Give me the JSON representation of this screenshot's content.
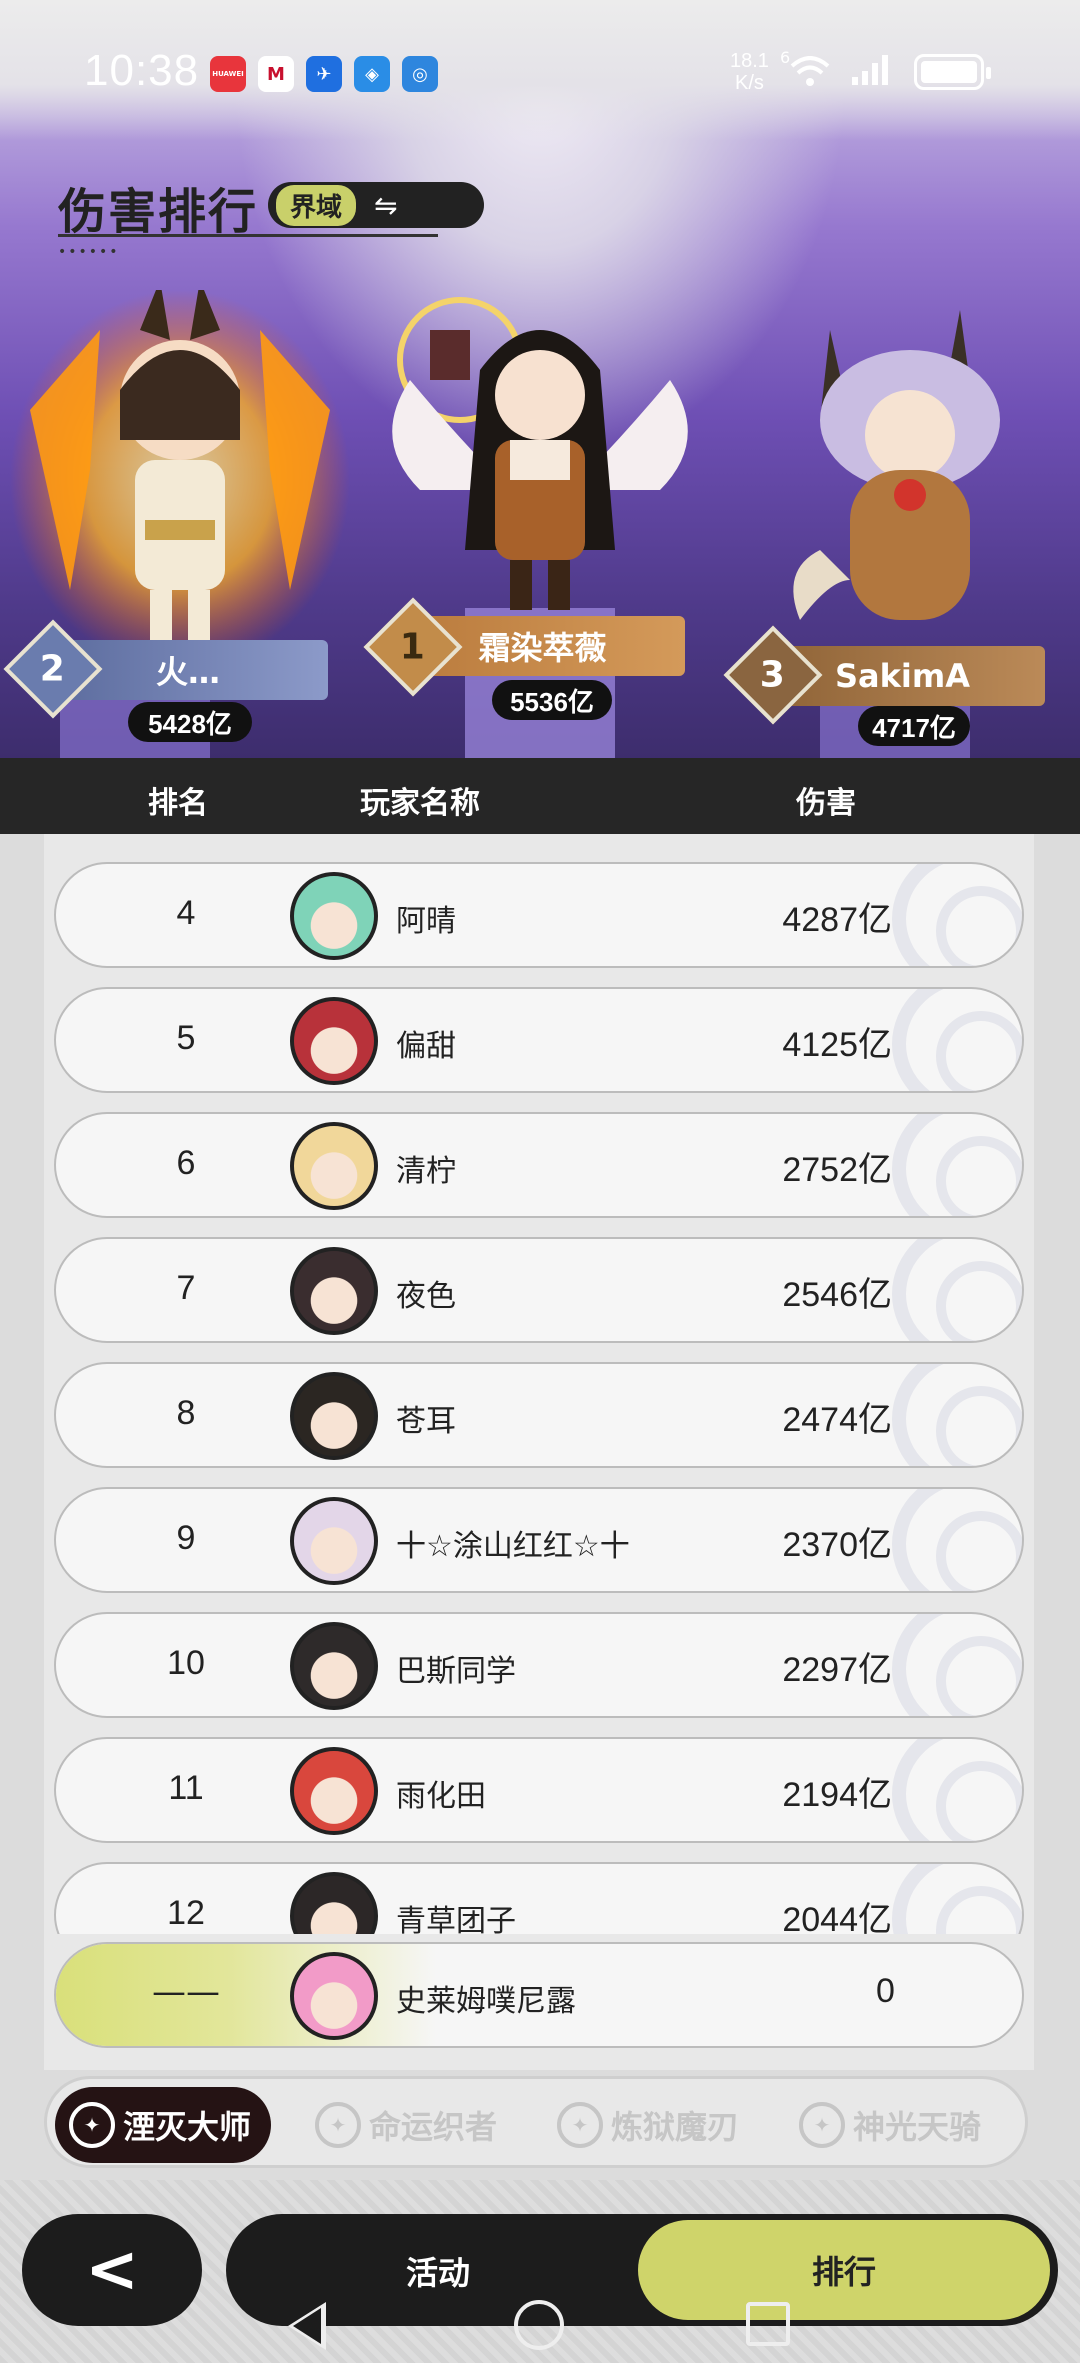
{
  "status": {
    "time": "10:38",
    "net_speed_value": "18.1",
    "net_speed_unit": "K/s",
    "signal_label": "6",
    "apps": [
      {
        "icon": "huawei-icon",
        "label": "HUAWEI",
        "color": "#e8353c"
      },
      {
        "icon": "metro-icon",
        "label": "M",
        "color": "#ffffff"
      },
      {
        "icon": "bird-icon",
        "label": "✈",
        "color": "#1f6fe0"
      },
      {
        "icon": "shield-icon",
        "label": "◈",
        "color": "#2a8de6"
      },
      {
        "icon": "bulb-icon",
        "label": "◎",
        "color": "#2e86de"
      }
    ]
  },
  "header": {
    "title": "伤害排行",
    "realm_label": "界域",
    "swap_symbol": "⇋",
    "dots": "••••••"
  },
  "podium": {
    "first": {
      "rank": "1",
      "name": "霜染萃薇",
      "score": "5536亿"
    },
    "second": {
      "rank": "2",
      "name": "火…",
      "score": "5428亿"
    },
    "third": {
      "rank": "3",
      "name": "SakimA",
      "score": "4717亿"
    }
  },
  "table": {
    "col_rank": "排名",
    "col_name": "玩家名称",
    "col_damage": "伤害",
    "rows": [
      {
        "rank": "4",
        "name": "阿晴",
        "damage": "4287亿",
        "avatar_color": "#7fd3b8"
      },
      {
        "rank": "5",
        "name": "偏甜",
        "damage": "4125亿",
        "avatar_color": "#b8323a"
      },
      {
        "rank": "6",
        "name": "清柠",
        "damage": "2752亿",
        "avatar_color": "#f1d79a"
      },
      {
        "rank": "7",
        "name": "夜色",
        "damage": "2546亿",
        "avatar_color": "#3a2d2f"
      },
      {
        "rank": "8",
        "name": "苍耳",
        "damage": "2474亿",
        "avatar_color": "#2b2622"
      },
      {
        "rank": "9",
        "name": "十☆涂山红红☆十",
        "damage": "2370亿",
        "avatar_color": "#e3d6e8"
      },
      {
        "rank": "10",
        "name": "巴斯同学",
        "damage": "2297亿",
        "avatar_color": "#2e2a2a"
      },
      {
        "rank": "11",
        "name": "雨化田",
        "damage": "2194亿",
        "avatar_color": "#d9473d"
      },
      {
        "rank": "12",
        "name": "青草团子",
        "damage": "2044亿",
        "avatar_color": "#2c2727"
      }
    ],
    "self": {
      "rank": "——",
      "name": "史莱姆噗尼露",
      "damage": "0",
      "avatar_color": "#f29bc8"
    }
  },
  "class_tabs": [
    {
      "label": "湮灭大师",
      "icon": "annihilation-icon",
      "active": true
    },
    {
      "label": "命运织者",
      "icon": "fate-icon",
      "active": false
    },
    {
      "label": "炼狱魔刃",
      "icon": "purgatory-icon",
      "active": false
    },
    {
      "label": "神光天骑",
      "icon": "holy-knight-icon",
      "active": false
    }
  ],
  "bottom_nav": {
    "back_symbol": "<",
    "activity": "活动",
    "ranking": "排行"
  },
  "colors": {
    "accent": "#cfd46a",
    "dark": "#1c1c1c",
    "hero_purple": "#6e4fb4"
  }
}
